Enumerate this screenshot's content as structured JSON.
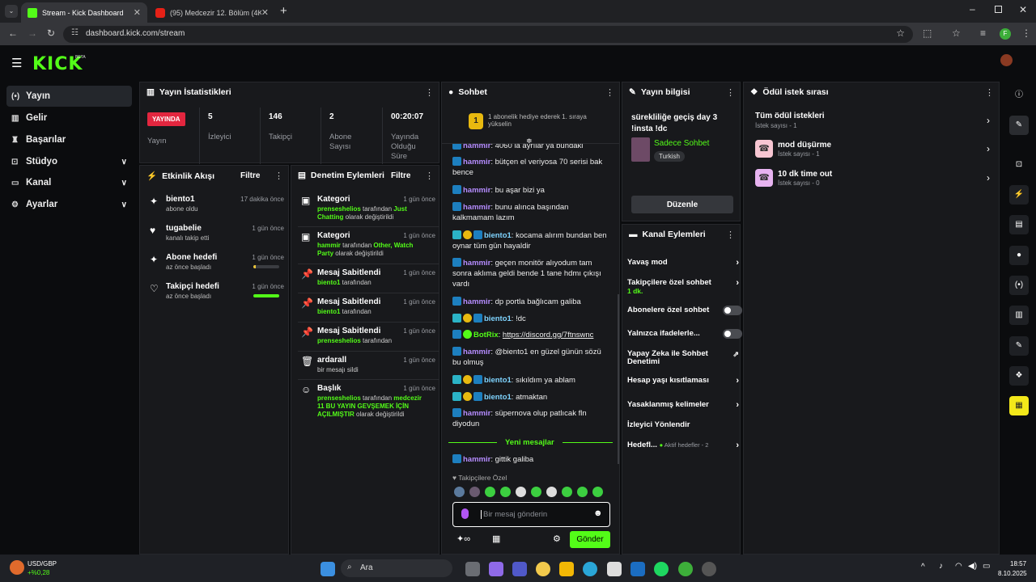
{
  "browser": {
    "tabs": [
      {
        "title": "Stream - Kick Dashboard",
        "active": true
      },
      {
        "title": "(95) Medcezir 12. Bölüm (4K) -",
        "active": false
      }
    ],
    "url": "dashboard.kick.com/stream",
    "profile_initial": "F"
  },
  "header": {
    "logo": "KICK",
    "beta": "BETA"
  },
  "sidebar": {
    "items": [
      {
        "label": "Yayın",
        "icon": "broadcast-icon",
        "active": true
      },
      {
        "label": "Gelir",
        "icon": "revenue-icon"
      },
      {
        "label": "Başarılar",
        "icon": "trophy-icon"
      },
      {
        "label": "Stüdyo",
        "icon": "studio-icon",
        "expandable": true
      },
      {
        "label": "Kanal",
        "icon": "channel-icon",
        "expandable": true
      },
      {
        "label": "Ayarlar",
        "icon": "settings-icon",
        "expandable": true
      }
    ]
  },
  "stats": {
    "title": "Yayın İstatistikleri",
    "live_badge": "YAYINDA",
    "live_label": "Yayın",
    "items": [
      {
        "value": "5",
        "label": "İzleyici"
      },
      {
        "value": "146",
        "label": "Takipçi"
      },
      {
        "value": "2",
        "label": "Abone Sayısı"
      },
      {
        "value": "00:20:07",
        "label": "Yayında Olduğu Süre"
      }
    ]
  },
  "activity": {
    "title": "Etkinlik Akışı",
    "filter": "Filtre",
    "items": [
      {
        "title": "biento1",
        "sub": "abone oldu",
        "time": "17 dakika önce",
        "icon": "sparkle-icon"
      },
      {
        "title": "tugabelie",
        "sub": "kanalı takip etti",
        "time": "1 gün önce",
        "icon": "heart-icon"
      },
      {
        "title": "Abone hedefi",
        "sub": "az önce başladı",
        "time": "1 gün önce",
        "icon": "sparkle-icon",
        "progress": 0.08,
        "bar_color": "#e8c33a"
      },
      {
        "title": "Takipçi hedefi",
        "sub": "az önce başladı",
        "time": "1 gün önce",
        "icon": "heart-outline-icon",
        "progress": 1.0,
        "bar_color": "#53fc18"
      }
    ]
  },
  "moderation": {
    "title": "Denetim Eylemleri",
    "filter": "Filtre",
    "items": [
      {
        "title": "Kategori",
        "time": "1 gün önce",
        "icon": "category-icon",
        "user": "prenseshelios",
        "mid": " tarafından ",
        "value": "Just Chatting",
        "end": " olarak değiştirildi"
      },
      {
        "title": "Kategori",
        "time": "1 gün önce",
        "icon": "category-icon",
        "user": "hammir",
        "mid": " tarafından ",
        "value": "Other, Watch Party",
        "end": " olarak değiştirildi"
      },
      {
        "title": "Mesaj Sabitlendi",
        "time": "1 gün önce",
        "icon": "pin-icon",
        "user": "biento1",
        "mid": " tarafından",
        "value": "",
        "end": ""
      },
      {
        "title": "Mesaj Sabitlendi",
        "time": "1 gün önce",
        "icon": "pin-icon",
        "user": "biento1",
        "mid": " tarafından",
        "value": "",
        "end": ""
      },
      {
        "title": "Mesaj Sabitlendi",
        "time": "1 gün önce",
        "icon": "pin-icon",
        "user": "prenseshelios",
        "mid": " tarafından",
        "value": "",
        "end": ""
      },
      {
        "title": "ardarall",
        "time": "1 gün önce",
        "icon": "trash-icon",
        "user": "",
        "mid": "bir mesajı sildi",
        "value": "",
        "end": ""
      },
      {
        "title": "Başlık",
        "time": "1 gün önce",
        "icon": "title-icon",
        "user": "prenseshelios",
        "mid": " tarafından ",
        "value": "medcezir 11 BU YAYIN GEVŞEMEK İÇİN AÇILMIŞTIR",
        "end": " olarak değiştirildi"
      }
    ]
  },
  "chat": {
    "title": "Sohbet",
    "gift_banner": "1 abonelik hediye ederek 1. sıraya yükselin",
    "gift_rank": "1",
    "messages": [
      {
        "user": "hammir",
        "color": "#b58cff",
        "badges": [
          "blue"
        ],
        "text": "4060 la ayrılar ya bundaki"
      },
      {
        "user": "hammir",
        "color": "#b58cff",
        "badges": [
          "blue"
        ],
        "text": "bütçen el veriyosa 70 serisi bak bence"
      },
      {
        "user": "hammir",
        "color": "#b58cff",
        "badges": [
          "blue"
        ],
        "text": "bu aşar bizi ya"
      },
      {
        "user": "hammir",
        "color": "#b58cff",
        "badges": [
          "blue"
        ],
        "text": "bunu alınca başından kalkmamam lazım"
      },
      {
        "user": "biento1",
        "color": "#7fd4ff",
        "badges": [
          "teal",
          "sub",
          "blue"
        ],
        "text": "kocama alırım bundan ben oynar tüm gün hayaldir"
      },
      {
        "user": "hammir",
        "color": "#b58cff",
        "badges": [
          "blue"
        ],
        "text": "geçen monitör alıyodum tam sonra aklıma geldi bende 1 tane hdmı çıkışı vardı"
      },
      {
        "user": "hammir",
        "color": "#b58cff",
        "badges": [
          "blue"
        ],
        "text": "dp portla bağlıcam galiba"
      },
      {
        "user": "biento1",
        "color": "#7fd4ff",
        "badges": [
          "teal",
          "sub",
          "blue"
        ],
        "text": "!dc"
      },
      {
        "user": "BotRix",
        "color": "#53fc18",
        "badges": [
          "blue",
          "bot"
        ],
        "text": "https://discord.gg/7ftnswnc",
        "link": true
      },
      {
        "user": "hammir",
        "color": "#b58cff",
        "badges": [
          "blue"
        ],
        "text": "@biento1 en güzel günün sözü bu olmuş"
      },
      {
        "user": "biento1",
        "color": "#7fd4ff",
        "badges": [
          "teal",
          "sub",
          "blue"
        ],
        "text": "sıkıldım ya ablam"
      },
      {
        "user": "biento1",
        "color": "#7fd4ff",
        "badges": [
          "teal",
          "sub",
          "blue"
        ],
        "text": "atmaktan"
      },
      {
        "user": "hammir",
        "color": "#b58cff",
        "badges": [
          "blue"
        ],
        "text": "süpernova olup patlıcak fln diyodun"
      }
    ],
    "new_messages": "Yeni mesajlar",
    "new_message": {
      "user": "hammir",
      "color": "#b58cff",
      "text": "gittik galiba"
    },
    "followers_only": "Takipçilere Özel",
    "input_placeholder": "Bir mesaj gönderin",
    "send": "Gönder"
  },
  "stream_info": {
    "title": "Yayın bilgisi",
    "stream_title": "sürekliliğe geçiş day 3 !insta !dc",
    "category": "Sadece Sohbet",
    "language": "Turkish",
    "edit": "Düzenle"
  },
  "channel_actions": {
    "title": "Kanal Eylemleri",
    "rows": [
      {
        "label": "Yavaş mod",
        "kind": "chev"
      },
      {
        "label": "Takipçilere özel sohbet",
        "sub": "1 dk.",
        "kind": "chev"
      },
      {
        "label": "Abonelere özel sohbet",
        "kind": "toggle"
      },
      {
        "label": "Yalnızca ifadelerle...",
        "kind": "toggle"
      },
      {
        "label": "Yapay Zeka ile Sohbet Denetimi",
        "kind": "ext"
      },
      {
        "label": "Hesap yaşı kısıtlaması",
        "kind": "chev"
      },
      {
        "label": "Yasaklanmış kelimeler",
        "kind": "chev"
      },
      {
        "label": "İzleyici Yönlendir",
        "kind": "none"
      },
      {
        "label": "Hedefl...",
        "sub": "Aktif hedefler - 2",
        "kind": "chev"
      }
    ]
  },
  "rewards": {
    "title": "Ödül istek sırası",
    "all_title": "Tüm ödül istekleri",
    "all_sub": "İstek sayısı - 1",
    "items": [
      {
        "title": "mod düşürme",
        "sub": "İstek sayısı - 1"
      },
      {
        "title": "10 dk time out",
        "sub": "İstek sayısı - 0"
      }
    ]
  },
  "taskbar": {
    "ticker": "USD/GBP",
    "ticker_change": "+%0,28",
    "search": "Ara",
    "time": "18:57",
    "date": "8.10.2025"
  }
}
